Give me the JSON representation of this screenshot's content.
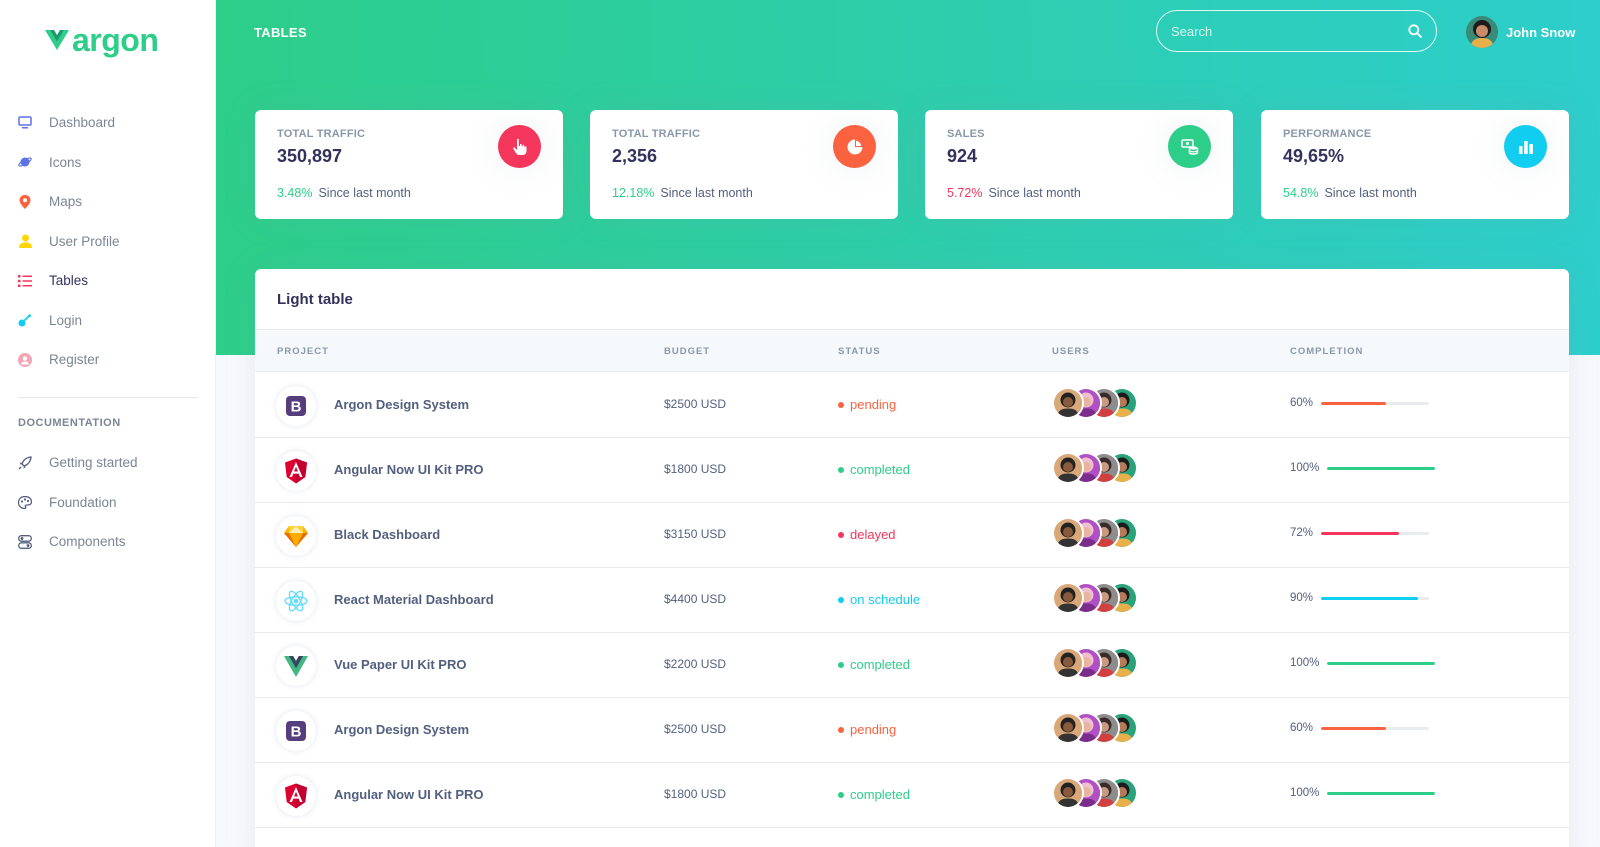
{
  "brand": {
    "name": "argon"
  },
  "sidebar": {
    "items": [
      {
        "label": "Dashboard",
        "icon": "tv-icon",
        "color": "#5e72e4"
      },
      {
        "label": "Icons",
        "icon": "planet-icon",
        "color": "#5e72e4"
      },
      {
        "label": "Maps",
        "icon": "pin-icon",
        "color": "#fb6340"
      },
      {
        "label": "User Profile",
        "icon": "user-icon",
        "color": "#ffd600"
      },
      {
        "label": "Tables",
        "icon": "list-icon",
        "color": "#f5365c"
      },
      {
        "label": "Login",
        "icon": "key-icon",
        "color": "#11cdef"
      },
      {
        "label": "Register",
        "icon": "circle-user-icon",
        "color": "#f3a4b5"
      }
    ],
    "doc_heading": "DOCUMENTATION",
    "doc_items": [
      {
        "label": "Getting started",
        "icon": "spaceship-icon"
      },
      {
        "label": "Foundation",
        "icon": "palette-icon"
      },
      {
        "label": "Components",
        "icon": "ui-04-icon"
      }
    ]
  },
  "header": {
    "title": "TABLES",
    "search_placeholder": "Search",
    "user_name": "John Snow"
  },
  "stats": [
    {
      "title": "TOTAL TRAFFIC",
      "value": "350,897",
      "pct": "3.48%",
      "trend": "up",
      "since": "Since last month",
      "icon": "hand-pointer-icon",
      "color": "#f5365c"
    },
    {
      "title": "TOTAL TRAFFIC",
      "value": "2,356",
      "pct": "12.18%",
      "trend": "up",
      "since": "Since last month",
      "icon": "pie-chart-icon",
      "color": "#fb6340"
    },
    {
      "title": "SALES",
      "value": "924",
      "pct": "5.72%",
      "trend": "down",
      "since": "Since last month",
      "icon": "money-coins-icon",
      "color": "#2dce89"
    },
    {
      "title": "PERFORMANCE",
      "value": "49,65%",
      "pct": "54.8%",
      "trend": "up",
      "since": "Since last month",
      "icon": "bar-chart-icon",
      "color": "#11cdef"
    }
  ],
  "table": {
    "title": "Light table",
    "columns": [
      "PROJECT",
      "BUDGET",
      "STATUS",
      "USERS",
      "COMPLETION"
    ],
    "rows": [
      {
        "project": "Argon Design System",
        "logo": "bootstrap-logo",
        "budget": "$2500 USD",
        "status": "pending",
        "status_color": "#fb6340",
        "completion": "60%",
        "completion_value": 0.6,
        "bar_color": "#fb6340"
      },
      {
        "project": "Angular Now UI Kit PRO",
        "logo": "angular-logo",
        "budget": "$1800 USD",
        "status": "completed",
        "status_color": "#2dce89",
        "completion": "100%",
        "completion_value": 1.0,
        "bar_color": "#2dce89"
      },
      {
        "project": "Black Dashboard",
        "logo": "sketch-logo",
        "budget": "$3150 USD",
        "status": "delayed",
        "status_color": "#f5365c",
        "completion": "72%",
        "completion_value": 0.72,
        "bar_color": "#f5365c"
      },
      {
        "project": "React Material Dashboard",
        "logo": "react-logo",
        "budget": "$4400 USD",
        "status": "on schedule",
        "status_color": "#11cdef",
        "completion": "90%",
        "completion_value": 0.9,
        "bar_color": "#11cdef"
      },
      {
        "project": "Vue Paper UI Kit PRO",
        "logo": "vue-logo",
        "budget": "$2200 USD",
        "status": "completed",
        "status_color": "#2dce89",
        "completion": "100%",
        "completion_value": 1.0,
        "bar_color": "#2dce89"
      },
      {
        "project": "Argon Design System",
        "logo": "bootstrap-logo",
        "budget": "$2500 USD",
        "status": "pending",
        "status_color": "#fb6340",
        "completion": "60%",
        "completion_value": 0.6,
        "bar_color": "#fb6340"
      },
      {
        "project": "Angular Now UI Kit PRO",
        "logo": "angular-logo",
        "budget": "$1800 USD",
        "status": "completed",
        "status_color": "#2dce89",
        "completion": "100%",
        "completion_value": 1.0,
        "bar_color": "#2dce89"
      }
    ]
  }
}
